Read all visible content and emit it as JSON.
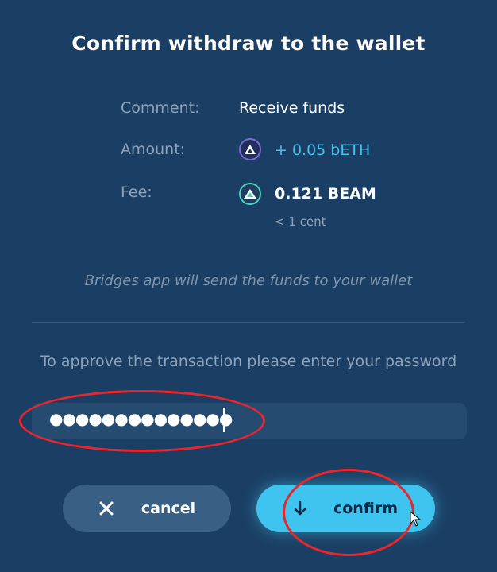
{
  "dialog": {
    "title": "Confirm withdraw to the wallet",
    "comment": {
      "label": "Comment:",
      "value": "Receive funds"
    },
    "amount": {
      "label": "Amount:",
      "value": "+ 0.05  bETH",
      "coin_icon": "beth-coin-icon"
    },
    "fee": {
      "label": "Fee:",
      "value": "0.121  BEAM",
      "sub": "< 1 cent",
      "coin_icon": "beam-coin-icon"
    },
    "note": "Bridges app will send the funds to your wallet",
    "prompt": "To approve the transaction please enter your password",
    "password": {
      "masked_value": "●●●●●●●●●●●●●●"
    },
    "buttons": {
      "cancel": "cancel",
      "confirm": "confirm"
    }
  },
  "colors": {
    "background": "#1b3f64",
    "accent": "#3fc4ef",
    "annotation": "#e8262b"
  }
}
